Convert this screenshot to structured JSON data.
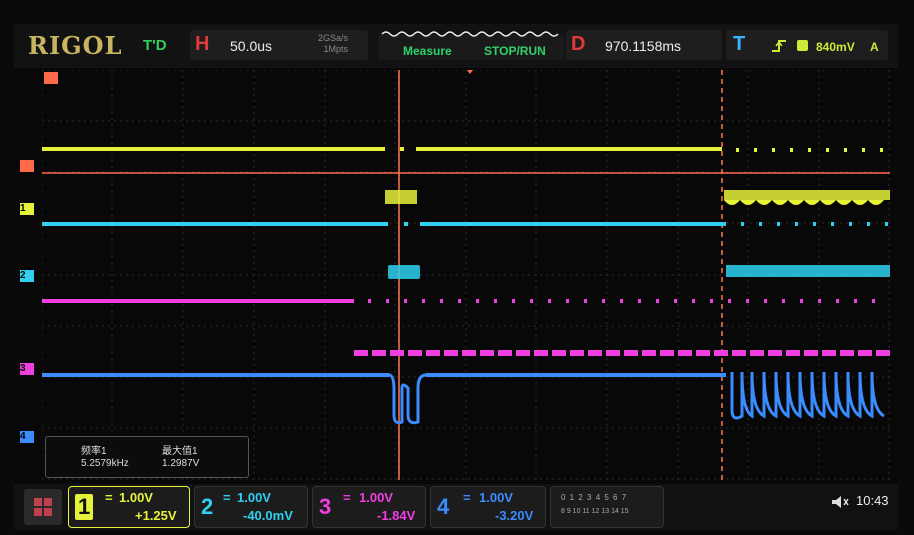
{
  "brand": "RIGOL",
  "trigger_state": "T'D",
  "horizontal": {
    "label": "H",
    "timebase": "50.0us",
    "sample_rate": "2GSa/s",
    "memory_depth": "1Mpts"
  },
  "menu": {
    "measure": "Measure",
    "stop_run": "STOP/RUN"
  },
  "delay": {
    "label": "D",
    "value": "970.1158ms"
  },
  "trigger": {
    "label": "T",
    "level": "840mV",
    "mode": "A"
  },
  "measurements": [
    {
      "name": "频率1",
      "value": "5.2579kHz"
    },
    {
      "name": "最大值1",
      "value": "1.2987V"
    }
  ],
  "channels": [
    {
      "num": "1",
      "scale": "1.00V",
      "offset": "+1.25V",
      "color": "#e6f23a"
    },
    {
      "num": "2",
      "scale": "1.00V",
      "offset": "-40.0mV",
      "color": "#2fd0f0"
    },
    {
      "num": "3",
      "scale": "1.00V",
      "offset": "-1.84V",
      "color": "#ef3fe0"
    },
    {
      "num": "4",
      "scale": "1.00V",
      "offset": "-3.20V",
      "color": "#3a8cff"
    }
  ],
  "status": {
    "digits": "0 1 2 3 4 5 6 7",
    "digits2": "8 9 10 11 12 13 14 15",
    "time": "10:43"
  },
  "colors": {
    "trigger_line": "#ff6a4a",
    "cursor": "#ff7a50"
  }
}
